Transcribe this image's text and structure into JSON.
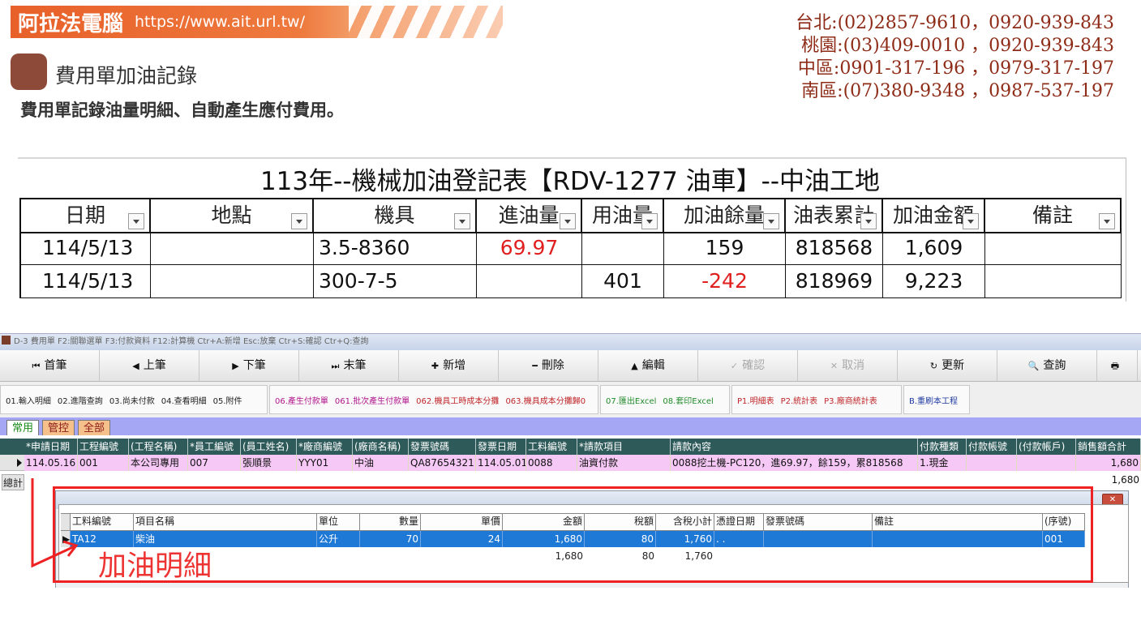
{
  "slide": {
    "brand_name": "阿拉法電腦",
    "brand_url": "https://www.ait.url.tw/",
    "section_title": "費用單加油記錄",
    "subtitle": "費用單記錄油量明細、自動產生應付費用。",
    "contacts": [
      "台北:(02)2857-9610，0920-939-843",
      "桃園:(03)409-0010 ，0920-939-843",
      "中區:0901-317-196 ，0979-317-197",
      "南區:(07)380-9348 ，0987-537-197"
    ],
    "colors": {
      "brand": "#e8602a",
      "contact": "#8e2c18",
      "annotation": "#e33333"
    }
  },
  "excel": {
    "title": "113年--機械加油登記表【RDV-1277 油車】--中油工地",
    "headers": [
      "日期",
      "地點",
      "機具",
      "進油量",
      "用油量",
      "加油餘量",
      "油表累計",
      "加油金額",
      "備註"
    ],
    "rows": [
      [
        "114/5/13",
        "",
        "3.5-8360",
        "69.97",
        "",
        "159",
        "818568",
        "1,609",
        ""
      ],
      [
        "114/5/13",
        "",
        "300-7-5",
        "",
        "401",
        "-242",
        "818969",
        "9,223",
        ""
      ]
    ]
  },
  "erp": {
    "title_bar": "D-3  費用單  F2:關聯選單  F3:付款資料  F12:計算機  Ctr+A:新增  Esc:放棄  Ctr+S:確認  Ctr+Q:查詢",
    "nav": {
      "first": "首筆",
      "prev": "上筆",
      "next": "下筆",
      "last": "末筆",
      "add": "新增",
      "delete": "刪除",
      "edit": "編輯",
      "confirm": "確認",
      "cancel": "取消",
      "refresh": "更新",
      "query": "查詢"
    },
    "func_groups": [
      [
        "01.輸入明細",
        "02.進階查詢",
        "03.尚未付款",
        "04.查看明細",
        "05.附件"
      ],
      [
        "06.產生付款單",
        "061.批次產生付款單",
        "062.機具工時成本分攤",
        "063.機具成本分攤歸0"
      ],
      [
        "07.匯出Excel",
        "08.套印Excel"
      ],
      [
        "P1.明細表",
        "P2.統計表",
        "P3.廠商統計表"
      ],
      [
        "B.重刷本工程"
      ]
    ],
    "tabs": [
      "常用",
      "管控",
      "全部"
    ],
    "grid": {
      "headers": [
        "*申請日期",
        "工程編號",
        "(工程名稱)",
        "*員工編號",
        "(員工姓名)",
        "*廠商編號",
        "(廠商名稱)",
        "發票號碼",
        "發票日期",
        "工料編號",
        "*請款項目",
        "請款內容",
        "付款種類",
        "付款帳號",
        "(付款帳戶)",
        "銷售額合計"
      ],
      "row": [
        "114.05.16",
        "001",
        "本公司專用",
        "007",
        "張順景",
        "YYY01",
        "中油",
        "QA87654321",
        "114.05.01",
        "0088",
        "油資付款",
        "0088挖土機-PC120，進69.97，餘159，累818568",
        "1.現金",
        "",
        "",
        "1,680"
      ],
      "total_label": "總計",
      "total_value": "1,680"
    },
    "detail": {
      "headers": [
        "工料編號",
        "項目名稱",
        "單位",
        "數量",
        "單價",
        "金額",
        "稅額",
        "含稅小計",
        "憑證日期",
        "發票號碼",
        "備註",
        "(序號)"
      ],
      "row": [
        "TA12",
        "柴油",
        "公升",
        "70",
        "24",
        "1,680",
        "80",
        "1,760",
        ". .",
        "",
        "",
        "001"
      ],
      "totals": {
        "amount": "1,680",
        "tax": "80",
        "subtotal": "1,760"
      },
      "annotation": "加油明細"
    }
  }
}
